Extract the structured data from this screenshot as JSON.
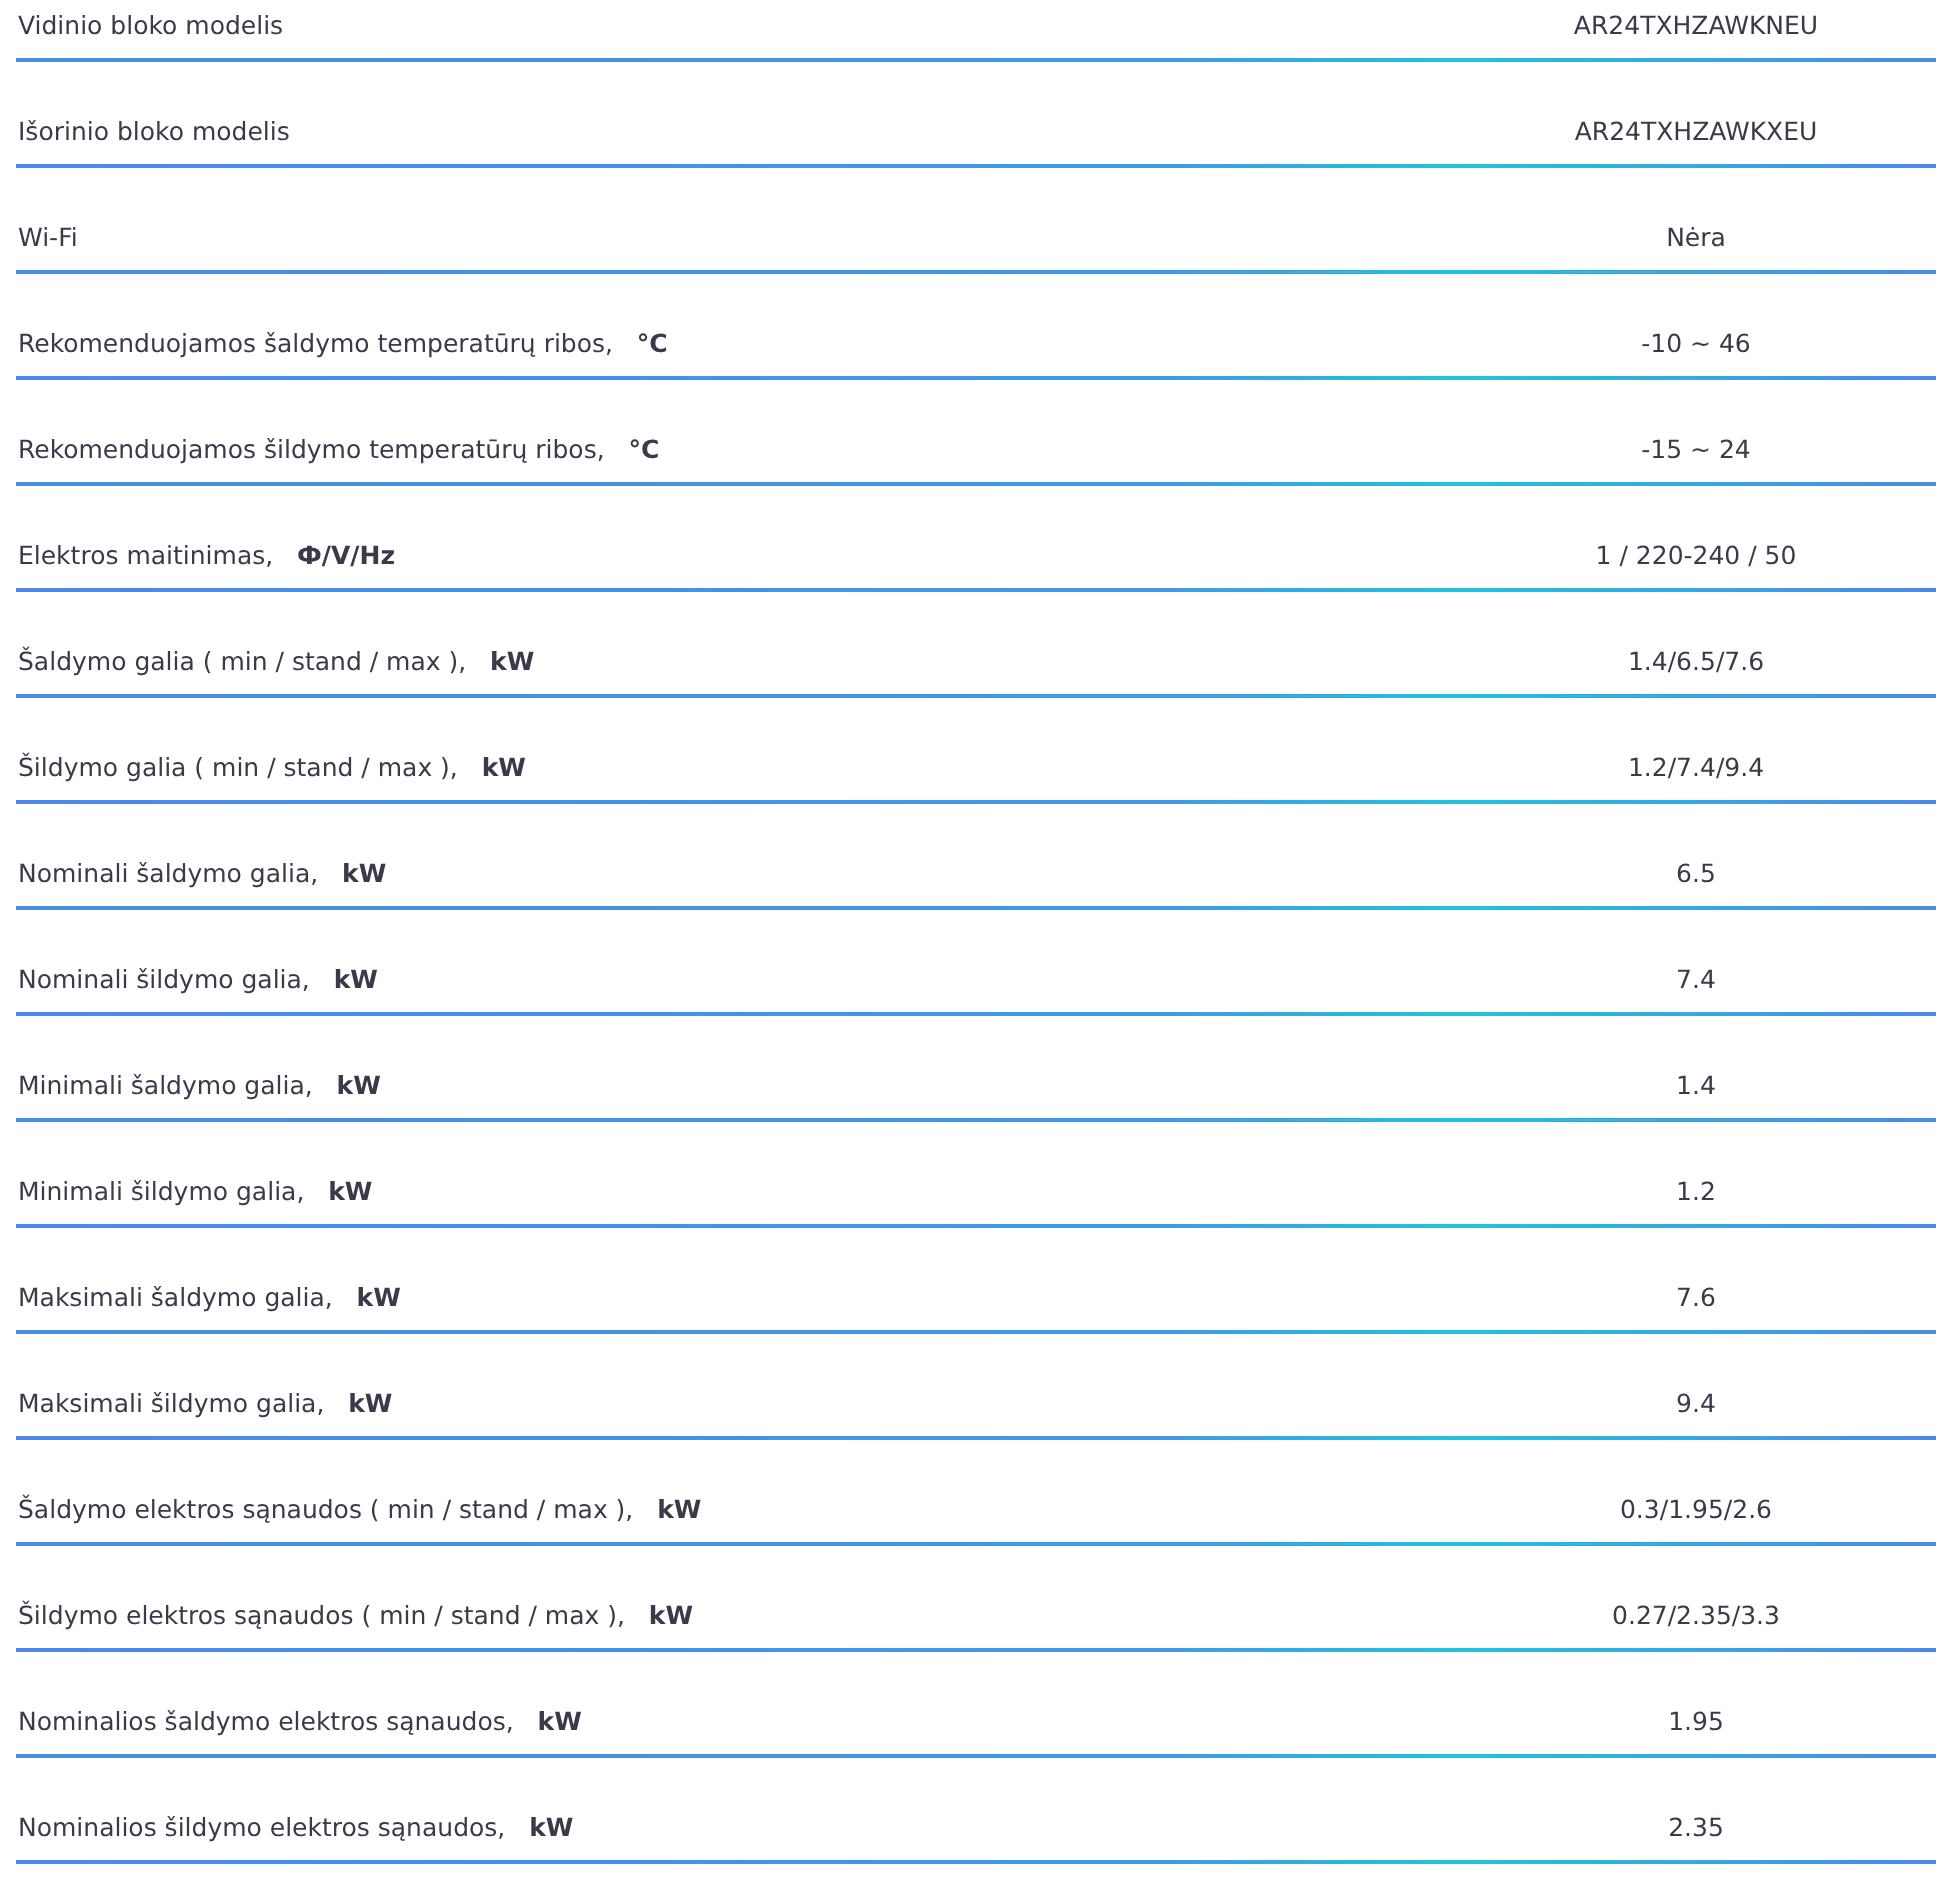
{
  "specs": [
    {
      "label": "Vidinio bloko modelis",
      "value": "AR24TXHZAWKNEU"
    },
    {
      "label": "Išorinio bloko modelis",
      "value": "AR24TXHZAWKXEU"
    },
    {
      "label": "Wi-Fi",
      "value": "Nėra"
    },
    {
      "label": "Rekomenduojamos šaldymo temperatūrų ribos,   **°C**",
      "value": "-10 ~ 46"
    },
    {
      "label": "Rekomenduojamos šildymo temperatūrų ribos,   **°C**",
      "value": "-15 ~ 24"
    },
    {
      "label": "Elektros maitinimas,   **Ф/V/Hz**",
      "value": "1 / 220-240 / 50"
    },
    {
      "label": "Šaldymo galia ( min / stand / max ),   **kW**",
      "value": "1.4/6.5/7.6"
    },
    {
      "label": "Šildymo galia ( min / stand / max ),   **kW**",
      "value": "1.2/7.4/9.4"
    },
    {
      "label": "Nominali šaldymo galia,   **kW**",
      "value": "6.5"
    },
    {
      "label": "Nominali šildymo galia,   **kW**",
      "value": "7.4"
    },
    {
      "label": "Minimali šaldymo galia,   **kW**",
      "value": "1.4"
    },
    {
      "label": "Minimali šildymo galia,   **kW**",
      "value": "1.2"
    },
    {
      "label": "Maksimali šaldymo galia,   **kW**",
      "value": "7.6"
    },
    {
      "label": "Maksimali šildymo galia,   **kW**",
      "value": "9.4"
    },
    {
      "label": "Šaldymo elektros sąnaudos ( min / stand / max ),   **kW**",
      "value": "0.3/1.95/2.6"
    },
    {
      "label": "Šildymo elektros sąnaudos ( min / stand / max ),   **kW**",
      "value": "0.27/2.35/3.3"
    },
    {
      "label": "Nominalios šaldymo elektros sąnaudos,   **kW**",
      "value": "1.95"
    },
    {
      "label": "Nominalios šildymo elektros sąnaudos,   **kW**",
      "value": "2.35"
    }
  ]
}
